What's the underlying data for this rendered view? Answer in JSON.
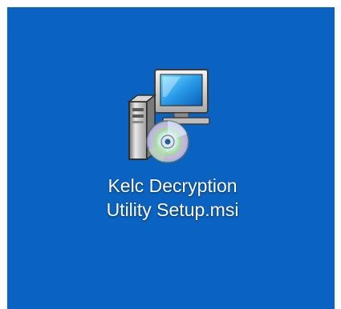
{
  "desktop": {
    "background_color": "#0a63c1",
    "icon": {
      "icon_name": "msi-installer-icon",
      "label_line1": "Kelc Decryption",
      "label_line2": "Utility Setup.msi"
    }
  }
}
